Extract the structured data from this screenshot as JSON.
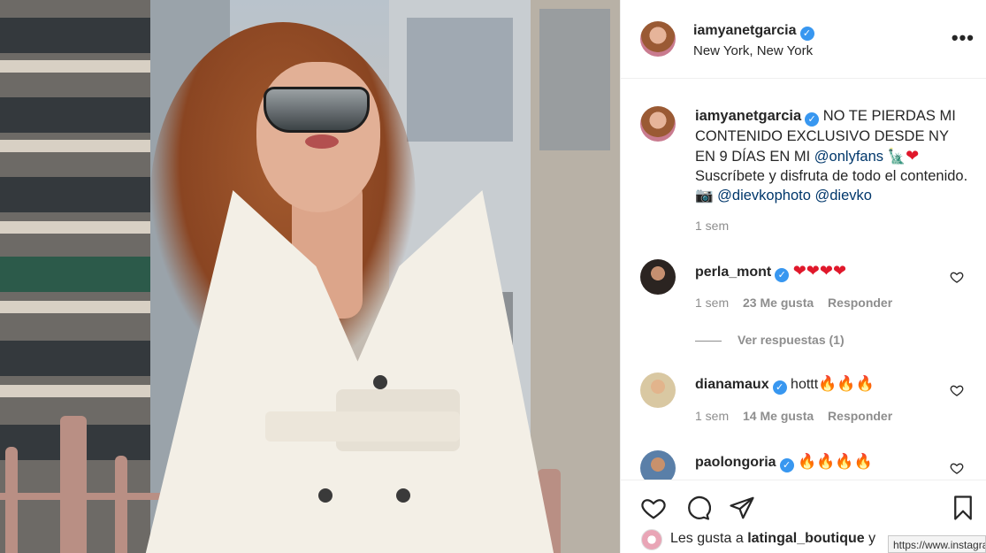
{
  "post": {
    "username": "iamyanetgarcia",
    "location": "New York, New York",
    "more_label": "•••",
    "verified_glyph": "✓"
  },
  "caption": {
    "username": "iamyanetgarcia",
    "text_part1": "NO TE PIERDAS MI CONTENIDO EXCLUSIVO DESDE NY EN 9 DÍAS EN MI",
    "mention1": "@onlyfans",
    "emoji1": "🗽",
    "emoji2": "❤",
    "text_part2": "Suscríbete y disfruta de todo el contenido.",
    "emoji3": "📷",
    "mention2": "@dievkophoto",
    "mention3": "@dievko",
    "time": "1 sem"
  },
  "comments": [
    {
      "username": "perla_mont",
      "text": "❤❤❤❤",
      "time": "1 sem",
      "likes": "23 Me gusta",
      "reply": "Responder"
    },
    {
      "username": "dianamaux",
      "text_plain": "hottt",
      "text_fire": "🔥🔥🔥",
      "time": "1 sem",
      "likes": "14 Me gusta",
      "reply": "Responder"
    },
    {
      "username": "paolongoria",
      "text": "🔥🔥🔥🔥"
    }
  ],
  "view_replies": "Ver respuestas (1)",
  "likes": {
    "prefix": "Les gusta a",
    "user": "latingal_boutique",
    "suffix": "y"
  },
  "status_url": "https://www.instagram.com/",
  "colors": {
    "verified": "#3897f0",
    "link": "#00376b",
    "muted": "#8e8e8e",
    "heart": "#e0182b"
  }
}
